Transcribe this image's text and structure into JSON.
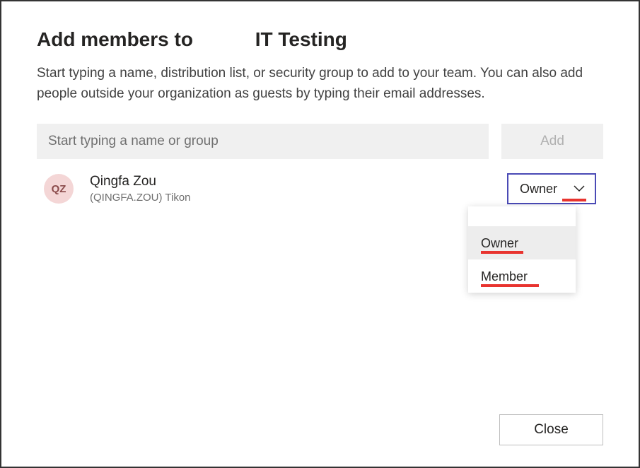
{
  "dialog": {
    "title_prefix": "Add members to",
    "title_team": "IT Testing",
    "subtitle": "Start typing a name, distribution list, or security group to add to your team. You can also add people outside your organization as guests by typing their email addresses."
  },
  "search": {
    "placeholder": "Start typing a name or group",
    "value": ""
  },
  "add_button": {
    "label": "Add"
  },
  "member": {
    "avatar_initials": "QZ",
    "name": "Qingfa Zou",
    "detail": "(QINGFA.ZOU) Tikon",
    "role_selected": "Owner"
  },
  "role_options": {
    "owner": "Owner",
    "member": "Member"
  },
  "close_button": {
    "label": "Close"
  },
  "colors": {
    "accent": "#4a4ab5",
    "annotation": "#e8342f"
  }
}
